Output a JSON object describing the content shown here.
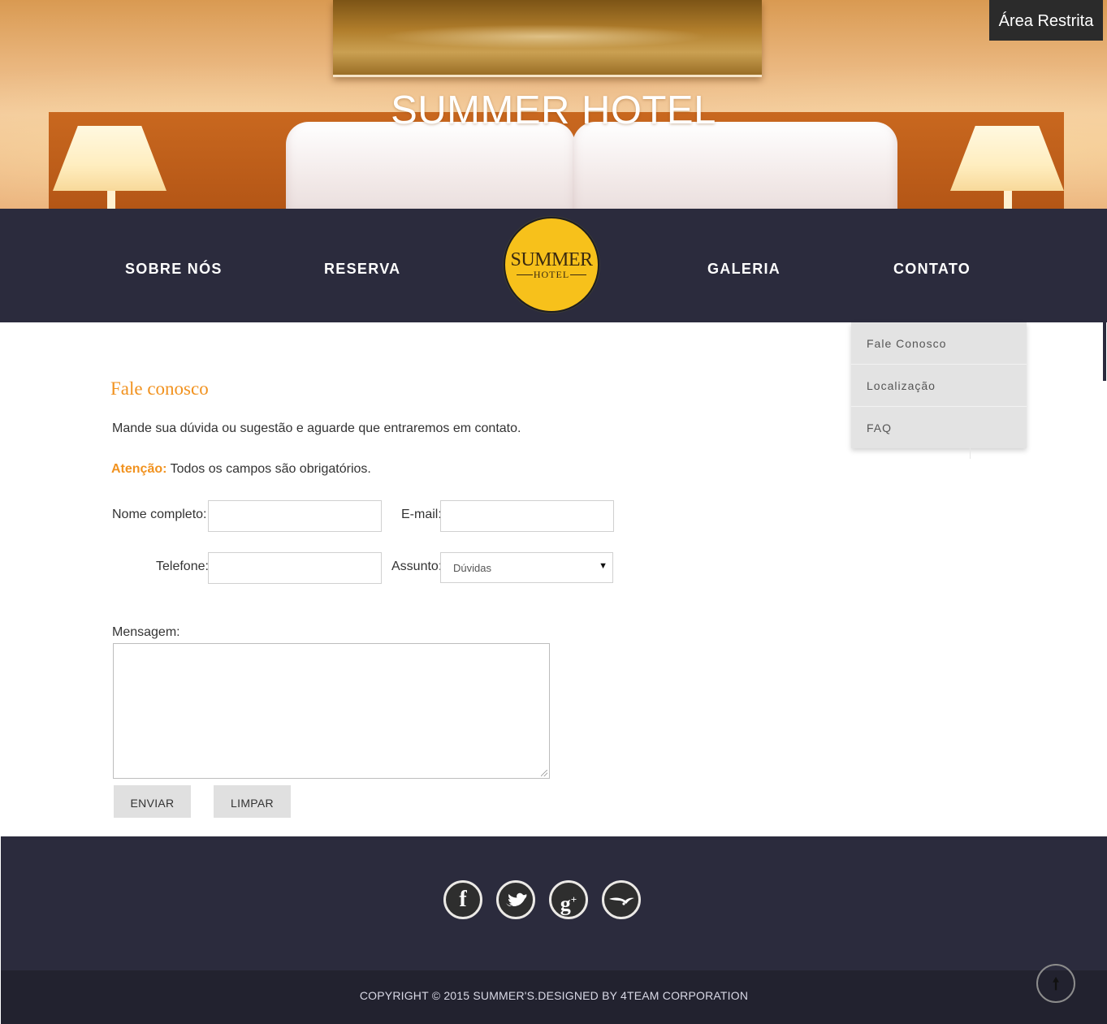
{
  "area_restrita": "Área Restrita",
  "hero": {
    "title": "SUMMER HOTEL"
  },
  "nav": {
    "items": [
      "SOBRE NÓS",
      "RESERVA",
      "GALERIA",
      "CONTATO"
    ],
    "logo": {
      "brand": "SUMMER",
      "sub": "HOTEL"
    }
  },
  "dropdown": {
    "items": [
      "Fale Conosco",
      "Localização",
      "FAQ"
    ]
  },
  "contact": {
    "title": "Fale conosco",
    "intro": "Mande sua dúvida ou sugestão e aguarde que entraremos em contato.",
    "notice_prefix": "Atenção:",
    "notice_text": " Todos os campos são obrigatórios.",
    "labels": {
      "name": "Nome completo:",
      "email": "E-mail:",
      "phone": "Telefone:",
      "subject": "Assunto:",
      "message": "Mensagem:"
    },
    "values": {
      "name": "",
      "email": "",
      "phone": "",
      "message": ""
    },
    "subject_selected": "Dúvidas",
    "buttons": {
      "send": "ENVIAR",
      "clear": "LIMPAR"
    }
  },
  "footer": {
    "social": [
      "facebook-icon",
      "twitter-icon",
      "google-plus-icon",
      "bird-icon"
    ],
    "copyright": "COPYRIGHT © 2015 SUMMER'S.DESIGNED BY 4TEAM CORPORATION"
  },
  "colors": {
    "accent": "#f1921f",
    "nav_bg": "#2b2b3d",
    "logo_bg": "#f7c11b"
  }
}
